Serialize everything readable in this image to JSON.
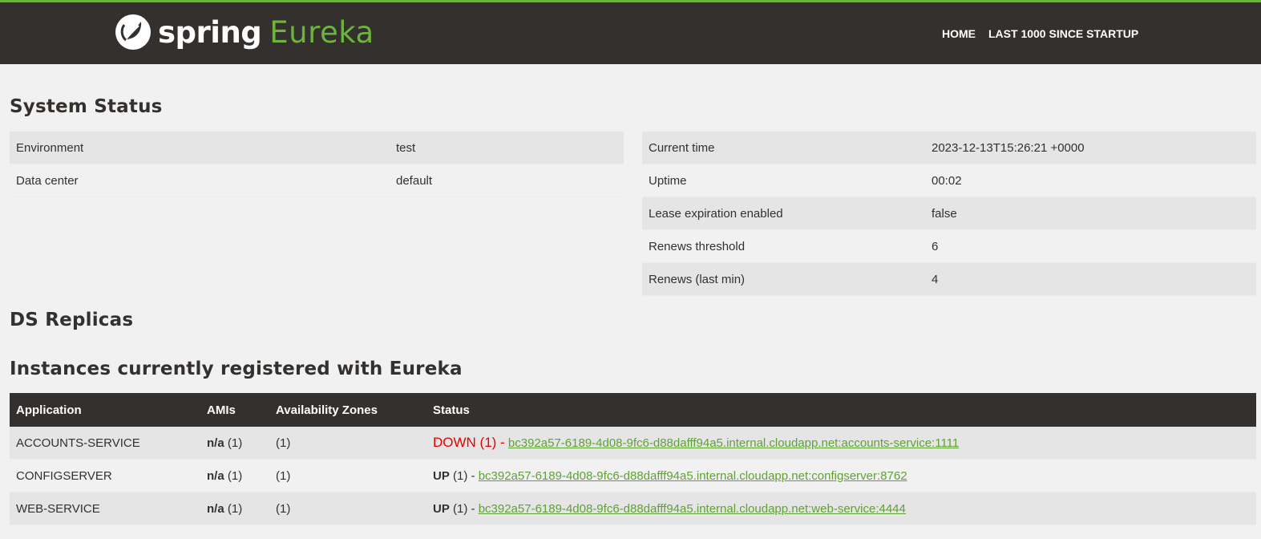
{
  "header": {
    "brand_spring": "spring",
    "brand_eureka": "Eureka",
    "nav": [
      {
        "label": "HOME"
      },
      {
        "label": "LAST 1000 SINCE STARTUP"
      }
    ],
    "accent_color": "#6db33f",
    "bar_color": "#34302d"
  },
  "system_status": {
    "title": "System Status",
    "left": [
      {
        "key": "Environment",
        "value": "test"
      },
      {
        "key": "Data center",
        "value": "default"
      }
    ],
    "right": [
      {
        "key": "Current time",
        "value": "2023-12-13T15:26:21 +0000"
      },
      {
        "key": "Uptime",
        "value": "00:02"
      },
      {
        "key": "Lease expiration enabled",
        "value": "false"
      },
      {
        "key": "Renews threshold",
        "value": "6"
      },
      {
        "key": "Renews (last min)",
        "value": "4"
      }
    ]
  },
  "ds_replicas": {
    "title": "DS Replicas"
  },
  "instances": {
    "title": "Instances currently registered with Eureka",
    "columns": [
      "Application",
      "AMIs",
      "Availability Zones",
      "Status"
    ],
    "rows": [
      {
        "application": "ACCOUNTS-SERVICE",
        "amis_bold": "n/a",
        "amis_count": "(1)",
        "zones": "(1)",
        "status": "DOWN (1) -",
        "link": "bc392a57-6189-4d08-9fc6-d88dafff94a5.internal.cloudapp.net:accounts-service:1111"
      },
      {
        "application": "CONFIGSERVER",
        "amis_bold": "n/a",
        "amis_count": "(1)",
        "zones": "(1)",
        "status_bold": "UP",
        "status_count": "(1) -",
        "link": "bc392a57-6189-4d08-9fc6-d88dafff94a5.internal.cloudapp.net:configserver:8762"
      },
      {
        "application": "WEB-SERVICE",
        "amis_bold": "n/a",
        "amis_count": "(1)",
        "zones": "(1)",
        "status_bold": "UP",
        "status_count": "(1) -",
        "link": "bc392a57-6189-4d08-9fc6-d88dafff94a5.internal.cloudapp.net:web-service:4444"
      }
    ]
  }
}
